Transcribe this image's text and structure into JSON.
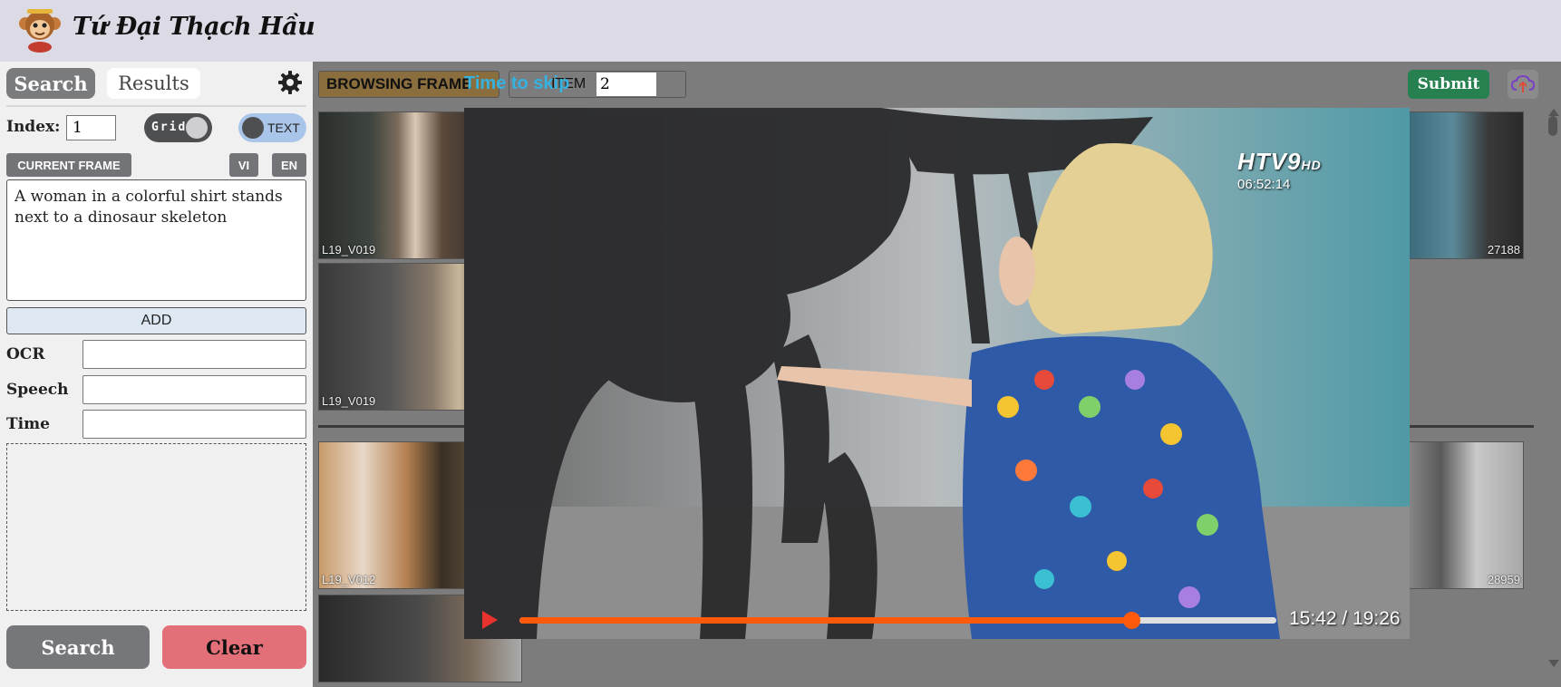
{
  "app": {
    "title": "Tứ Đại Thạch Hầu"
  },
  "left": {
    "tabs": {
      "search": "Search",
      "results": "Results"
    },
    "index_label": "Index:",
    "index_value": "1",
    "grid_toggle": "Grid",
    "text_toggle": "TEXT",
    "current_frame": "CURRENT FRAME",
    "vi": "VI",
    "en": "EN",
    "query": "A woman in a colorful shirt stands next to a dinosaur skeleton",
    "add": "ADD",
    "ocr_label": "OCR",
    "speech_label": "Speech",
    "time_label": "Time",
    "search_button": "Search",
    "clear_button": "Clear"
  },
  "main": {
    "browsing": "BROWSING FRAME",
    "item_label": "ITEM",
    "item_value": "2",
    "submit": "Submit",
    "thumbs": [
      {
        "label": "L19_V019",
        "number": ""
      },
      {
        "label": "L19_V019",
        "number": ""
      },
      {
        "label": "L19_V012",
        "number": ""
      },
      {
        "label": "",
        "number": "27188"
      },
      {
        "label": "",
        "number": "28959"
      }
    ]
  },
  "player": {
    "skip_label": "Time to skip",
    "channel": "HTV9",
    "channel_hd": "HD",
    "channel_time": "06:52:14",
    "time": "15:42 / 19:26",
    "progress": 0.808,
    "colors": {
      "progress": "#ff5a0a",
      "play": "#e8322e"
    }
  }
}
